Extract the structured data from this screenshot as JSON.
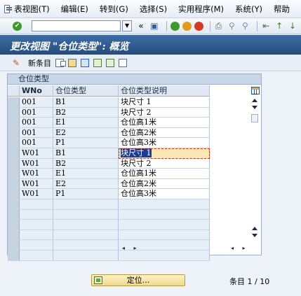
{
  "menu": [
    "表视图(T)",
    "编辑(E)",
    "转到(G)",
    "选择(S)",
    "实用程序(M)",
    "系统(Y)",
    "帮助"
  ],
  "page_title": "更改视图 \"仓位类型\": 概览",
  "app_toolbar": {
    "new_entries_label": "新条目"
  },
  "table": {
    "title": "仓位类型",
    "columns": [
      "WNo",
      "仓位类型",
      "仓位类型说明"
    ],
    "rows": [
      [
        "001",
        "B1",
        "块尺寸 1"
      ],
      [
        "001",
        "B2",
        "块尺寸 2"
      ],
      [
        "001",
        "E1",
        "仓位高1米"
      ],
      [
        "001",
        "E2",
        "仓位高2米"
      ],
      [
        "001",
        "P1",
        "仓位高3米"
      ],
      [
        "W01",
        "B1",
        "块尺寸 1"
      ],
      [
        "W01",
        "B2",
        "块尺寸 2"
      ],
      [
        "W01",
        "E1",
        "仓位高1米"
      ],
      [
        "W01",
        "E2",
        "仓位高2米"
      ],
      [
        "W01",
        "P1",
        "仓位高3米"
      ]
    ],
    "focused_row_index": 5,
    "empty_row_count": 6,
    "nav_left": "◂ ▸",
    "nav_right": "◂ ▸"
  },
  "locate_button_label": "定位...",
  "entry_count": "条目 1 / 10"
}
